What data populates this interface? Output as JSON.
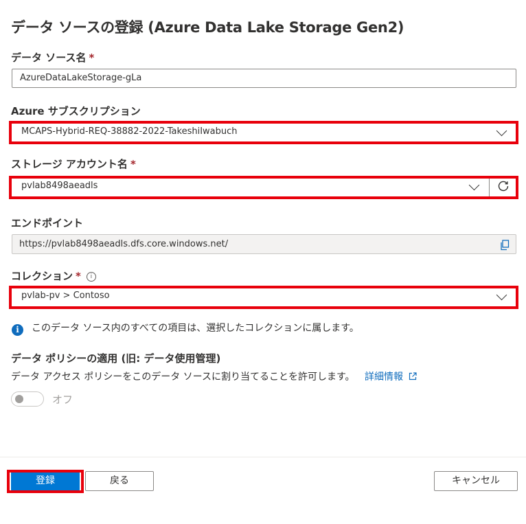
{
  "panel": {
    "title": "データ ソースの登録 (Azure Data Lake Storage Gen2)"
  },
  "fields": {
    "datasource_name": {
      "label": "データ ソース名",
      "required": "*",
      "value": "AzureDataLakeStorage-gLa"
    },
    "subscription": {
      "label": "Azure サブスクリプション",
      "value": "MCAPS-Hybrid-REQ-38882-2022-TakeshiIwabuch"
    },
    "storage_account": {
      "label": "ストレージ アカウント名",
      "required": "*",
      "value": "pvlab8498aeadls"
    },
    "endpoint": {
      "label": "エンドポイント",
      "value": "https://pvlab8498aeadls.dfs.core.windows.net/"
    },
    "collection": {
      "label": "コレクション",
      "required": "*",
      "value": "pvlab-pv > Contoso"
    }
  },
  "info_message": "このデータ ソース内のすべての項目は、選択したコレクションに属します。",
  "policy": {
    "heading": "データ ポリシーの適用 (旧: データ使用管理)",
    "description": "データ アクセス ポリシーをこのデータ ソースに割り当てることを許可します。",
    "link_text": "詳細情報",
    "toggle_label": "オフ",
    "toggle_on": false
  },
  "footer": {
    "register_label": "登録",
    "back_label": "戻る",
    "cancel_label": "キャンセル"
  },
  "icons": {
    "dropdown": "chevron-down-icon",
    "refresh": "refresh-icon",
    "copy": "copy-icon",
    "info": "info-icon",
    "external_link": "external-link-icon"
  },
  "colors": {
    "accent": "#0078d4",
    "highlight": "#e8000b",
    "required": "#a4262c",
    "link": "#0f6cbd"
  }
}
